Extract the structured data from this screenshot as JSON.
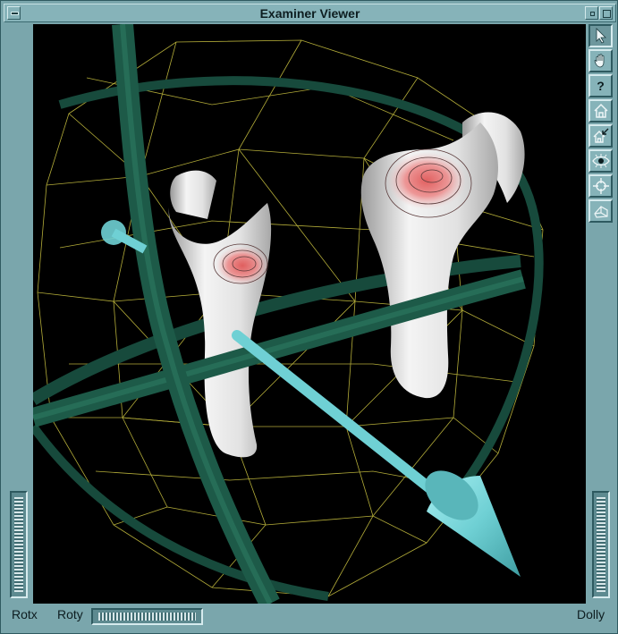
{
  "window": {
    "title": "Examiner Viewer"
  },
  "toolbar": {
    "buttons": [
      {
        "name": "pick-mode",
        "icon": "arrow-pointer-icon",
        "glyph": "",
        "pressed": true
      },
      {
        "name": "view-mode",
        "icon": "hand-icon",
        "glyph": "",
        "pressed": false
      },
      {
        "name": "help",
        "icon": "question-mark-icon",
        "glyph": "?",
        "pressed": false
      },
      {
        "name": "home",
        "icon": "home-icon",
        "glyph": "",
        "pressed": false
      },
      {
        "name": "set-home",
        "icon": "set-home-icon",
        "glyph": "",
        "pressed": false
      },
      {
        "name": "view-all",
        "icon": "eye-icon",
        "glyph": "",
        "pressed": false
      },
      {
        "name": "seek",
        "icon": "crosshair-icon",
        "glyph": "",
        "pressed": false
      },
      {
        "name": "projection",
        "icon": "perspective-cube-icon",
        "glyph": "",
        "pressed": false
      }
    ]
  },
  "wheels": {
    "rotx_label": "Rotx",
    "roty_label": "Roty",
    "dolly_label": "Dolly"
  },
  "colors": {
    "frame": "#7aa6ac",
    "viewport_bg": "#000000",
    "ring": "#1d5a48",
    "wireframe": "#c8c040",
    "arrow": "#6fd0d4",
    "bone": "#e6e6e6",
    "hotspot": "#e07070"
  }
}
